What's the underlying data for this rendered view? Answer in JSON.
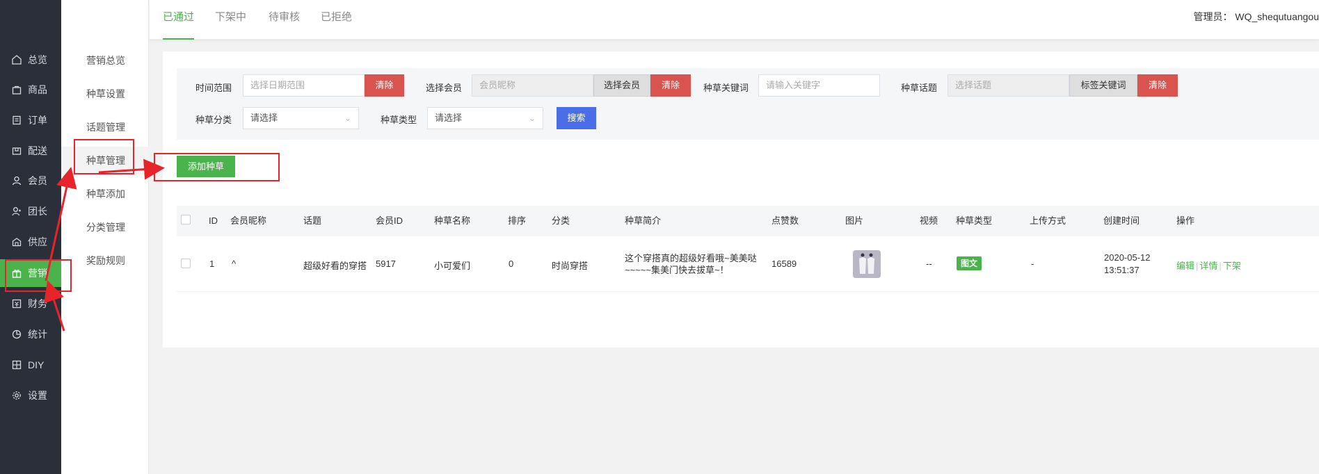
{
  "nav": {
    "items": [
      {
        "label": "总览",
        "icon": "home-icon"
      },
      {
        "label": "商品",
        "icon": "bag-icon"
      },
      {
        "label": "订单",
        "icon": "order-icon"
      },
      {
        "label": "配送",
        "icon": "delivery-icon"
      },
      {
        "label": "会员",
        "icon": "user-icon"
      },
      {
        "label": "团长",
        "icon": "leader-icon"
      },
      {
        "label": "供应",
        "icon": "supply-icon"
      },
      {
        "label": "营销",
        "icon": "gift-icon"
      },
      {
        "label": "财务",
        "icon": "finance-icon"
      },
      {
        "label": "统计",
        "icon": "chart-icon"
      },
      {
        "label": "DIY",
        "icon": "diy-icon"
      },
      {
        "label": "设置",
        "icon": "gear-icon"
      }
    ],
    "active_color": "#4bb34b"
  },
  "subnav": {
    "items": [
      "营销总览",
      "种草设置",
      "话题管理",
      "种草管理",
      "种草添加",
      "分类管理",
      "奖励规则"
    ]
  },
  "tabs": [
    "已通过",
    "下架中",
    "待审核",
    "已拒绝"
  ],
  "admin": "管理员： WQ_shequtuangou",
  "filter": {
    "time_label": "时间范围",
    "time_placeholder": "选择日期范围",
    "clear": "清除",
    "member_label": "选择会员",
    "member_placeholder": "会员昵称",
    "member_btn": "选择会员",
    "keyword_label": "种草关键词",
    "keyword_placeholder": "请输入关键字",
    "topic_label": "种草话题",
    "topic_placeholder": "选择话题",
    "topic_btn": "标签关键词",
    "category_label": "种草分类",
    "category_value": "请选择",
    "type_label": "种草类型",
    "type_value": "请选择",
    "search": "搜索"
  },
  "add_button": "添加种草",
  "table": {
    "headers": [
      "ID",
      "会员昵称",
      "话题",
      "会员ID",
      "种草名称",
      "排序",
      "分类",
      "种草简介",
      "点赞数",
      "图片",
      "视频",
      "种草类型",
      "上传方式",
      "创建时间",
      "操作"
    ],
    "rows": [
      {
        "id": "1",
        "nickname": "^",
        "topic": "超级好看的穿搭",
        "member_id": "5917",
        "name": "小可爱们",
        "sort": "0",
        "category": "时尚穿搭",
        "intro_line1": "这个穿搭真的超级好看哦~美美哒",
        "intro_line2": "~~~~~集美门快去拔草~！",
        "likes": "16589",
        "video": "--",
        "type": "图文",
        "upload": "-",
        "created_date": "2020-05-12",
        "created_time": "13:51:37",
        "ops": [
          "编辑",
          "详情",
          "下架"
        ]
      }
    ]
  },
  "colors": {
    "accent": "#4bb34b",
    "danger": "#d9534f",
    "primary": "#4a6ee8",
    "nav_bg": "#2b2f3a",
    "annotation": "#e8242b"
  }
}
